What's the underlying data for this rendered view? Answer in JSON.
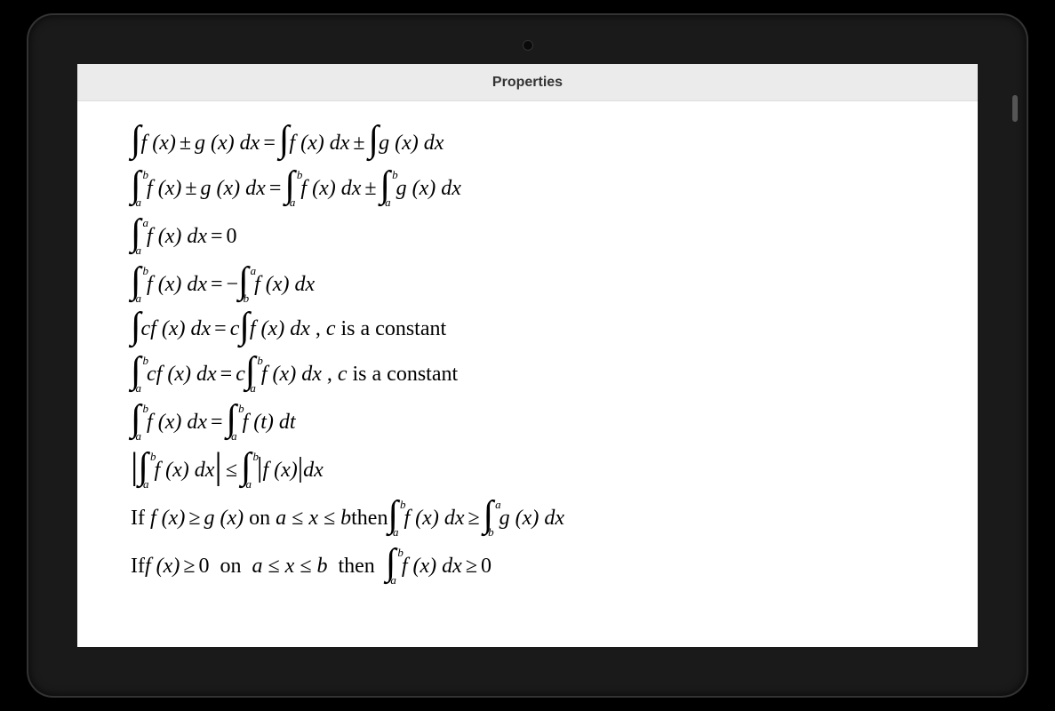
{
  "title": "Properties",
  "bounds": {
    "a": "a",
    "b": "b"
  },
  "fn": {
    "f": "f",
    "g": "g",
    "x": "x",
    "t": "t",
    "c": "c",
    "dx": "dx",
    "dt": "dt"
  },
  "ops": {
    "pm": "±",
    "eq": "=",
    "neg": "−",
    "le": "≤",
    "ge": "≥",
    "zero": "0"
  },
  "text": {
    "const_note": ", c is a constant",
    "if": "If ",
    "on": " on ",
    "then": " then ",
    "on_range_sep": " ≤ "
  },
  "formulas": [
    "∫ f(x) ± g(x) dx = ∫ f(x) dx ± ∫ g(x) dx",
    "∫_a^b f(x) ± g(x) dx = ∫_a^b f(x) dx ± ∫_a^b g(x) dx",
    "∫_a^a f(x) dx = 0",
    "∫_a^b f(x) dx = −∫_b^a f(x) dx",
    "∫ c f(x) dx = c ∫ f(x) dx , c is a constant",
    "∫_a^b c f(x) dx = c ∫_a^b f(x) dx , c is a constant",
    "∫_a^b f(x) dx = ∫_a^b f(t) dt",
    "|∫_a^b f(x) dx| ≤ ∫_a^b |f(x)| dx",
    "If f(x) ≥ g(x) on a ≤ x ≤ b then ∫_a^b f(x) dx ≥ ∫_b^a g(x) dx",
    "If f(x) ≥ 0 on a ≤ x ≤ b then ∫_a^b f(x) dx ≥ 0"
  ]
}
